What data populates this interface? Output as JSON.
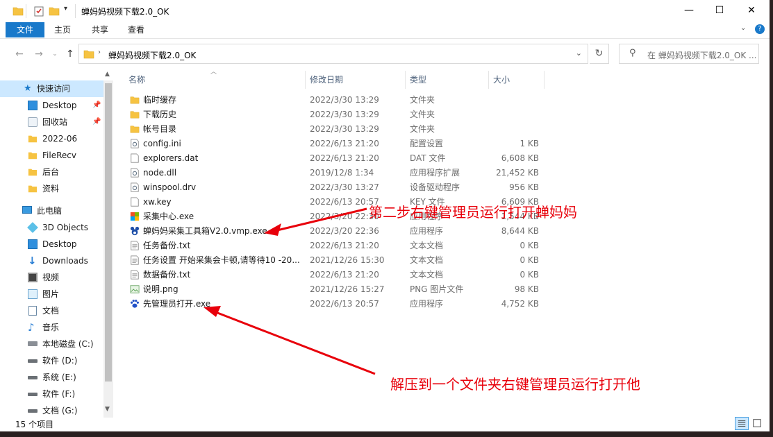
{
  "window": {
    "title": "蝉妈妈视频下载2.0_OK",
    "minimize": "—",
    "maximize": "☐",
    "close": "✕"
  },
  "ribbon": {
    "tabs": [
      "文件",
      "主页",
      "共享",
      "查看"
    ],
    "help_icon": "?"
  },
  "address": {
    "path": "蝉妈妈视频下载2.0_OK",
    "search_placeholder": "在 蝉妈妈视频下载2.0_OK ..."
  },
  "nav": {
    "quick_access": "快速访问",
    "items": [
      {
        "label": "Desktop",
        "icon": "desktop-icon",
        "pinned": true
      },
      {
        "label": "回收站",
        "icon": "recycle-bin-icon",
        "pinned": true
      },
      {
        "label": "2022-06",
        "icon": "folder-icon"
      },
      {
        "label": "FileRecv",
        "icon": "folder-icon"
      },
      {
        "label": "后台",
        "icon": "folder-icon"
      },
      {
        "label": "资料",
        "icon": "folder-icon"
      }
    ],
    "this_pc": "此电脑",
    "pc_items": [
      {
        "label": "3D Objects",
        "icon": "3d-objects-icon"
      },
      {
        "label": "Desktop",
        "icon": "desktop-icon"
      },
      {
        "label": "Downloads",
        "icon": "downloads-icon"
      },
      {
        "label": "视频",
        "icon": "video-icon"
      },
      {
        "label": "图片",
        "icon": "picture-icon"
      },
      {
        "label": "文档",
        "icon": "document-icon"
      },
      {
        "label": "音乐",
        "icon": "music-icon"
      },
      {
        "label": "本地磁盘 (C:)",
        "icon": "drive-icon"
      },
      {
        "label": "软件 (D:)",
        "icon": "drive-icon"
      },
      {
        "label": "系统 (E:)",
        "icon": "drive-icon"
      },
      {
        "label": "软件 (F:)",
        "icon": "drive-icon"
      },
      {
        "label": "文档 (G:)",
        "icon": "drive-icon"
      }
    ]
  },
  "columns": {
    "name": "名称",
    "date": "修改日期",
    "type": "类型",
    "size": "大小"
  },
  "files": [
    {
      "name": "临时缓存",
      "date": "2022/3/30 13:29",
      "type": "文件夹",
      "size": "",
      "icon": "folder"
    },
    {
      "name": "下载历史",
      "date": "2022/3/30 13:29",
      "type": "文件夹",
      "size": "",
      "icon": "folder"
    },
    {
      "name": "帐号目录",
      "date": "2022/3/30 13:29",
      "type": "文件夹",
      "size": "",
      "icon": "folder"
    },
    {
      "name": "config.ini",
      "date": "2022/6/13 21:20",
      "type": "配置设置",
      "size": "1 KB",
      "icon": "settings"
    },
    {
      "name": "explorers.dat",
      "date": "2022/6/13 21:20",
      "type": "DAT 文件",
      "size": "6,608 KB",
      "icon": "blank"
    },
    {
      "name": "node.dll",
      "date": "2019/12/8 1:34",
      "type": "应用程序扩展",
      "size": "21,452 KB",
      "icon": "settings"
    },
    {
      "name": "winspool.drv",
      "date": "2022/3/30 13:27",
      "type": "设备驱动程序",
      "size": "956 KB",
      "icon": "settings"
    },
    {
      "name": "xw.key",
      "date": "2022/6/13 20:57",
      "type": "KEY 文件",
      "size": "6,609 KB",
      "icon": "blank"
    },
    {
      "name": "采集中心.exe",
      "date": "2022/3/20 22:30",
      "type": "应用程序",
      "size": "1,544 KB",
      "icon": "app-colorful"
    },
    {
      "name": "蝉妈妈采集工具箱V2.0.vmp.exe",
      "date": "2022/3/20 22:36",
      "type": "应用程序",
      "size": "8,644 KB",
      "icon": "app-mouse"
    },
    {
      "name": "任务备份.txt",
      "date": "2022/6/13 21:20",
      "type": "文本文档",
      "size": "0 KB",
      "icon": "text"
    },
    {
      "name": "任务设置  开始采集会卡顿,请等待10 -20...",
      "date": "2021/12/26 15:30",
      "type": "文本文档",
      "size": "0 KB",
      "icon": "text"
    },
    {
      "name": "数据备份.txt",
      "date": "2022/6/13 21:20",
      "type": "文本文档",
      "size": "0 KB",
      "icon": "text"
    },
    {
      "name": "说明.png",
      "date": "2021/12/26 15:27",
      "type": "PNG 图片文件",
      "size": "98 KB",
      "icon": "image"
    },
    {
      "name": "先管理员打开.exe",
      "date": "2022/6/13 20:57",
      "type": "应用程序",
      "size": "4,752 KB",
      "icon": "app-paw"
    }
  ],
  "status": {
    "count": "15 个项目"
  },
  "annotations": {
    "step2": "第二步右键管理员运行打开蝉妈妈",
    "step1": "解压到一个文件夹右键管理员运行打开他",
    "color": "#e8000b"
  }
}
